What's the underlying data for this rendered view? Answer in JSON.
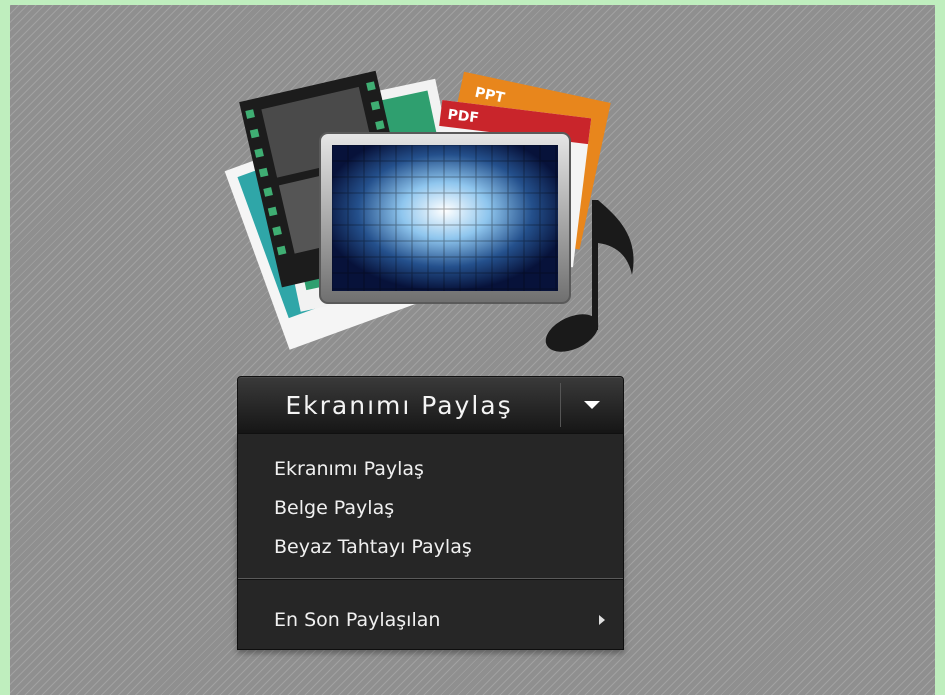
{
  "illustration": {
    "ppt_label": "PPT",
    "pdf_label": "PDF"
  },
  "share_button": {
    "label": "Ekranımı Paylaş"
  },
  "menu": {
    "items": [
      {
        "label": "Ekranımı Paylaş"
      },
      {
        "label": "Belge Paylaş"
      },
      {
        "label": "Beyaz Tahtayı Paylaş"
      }
    ],
    "recent": {
      "label": "En Son Paylaşılan"
    }
  },
  "colors": {
    "frame_green": "#bfeebe",
    "pod_gray": "#8f8f8f",
    "menu_bg": "#262626",
    "ppt_orange": "#e8861c",
    "pdf_red": "#c9252b"
  }
}
